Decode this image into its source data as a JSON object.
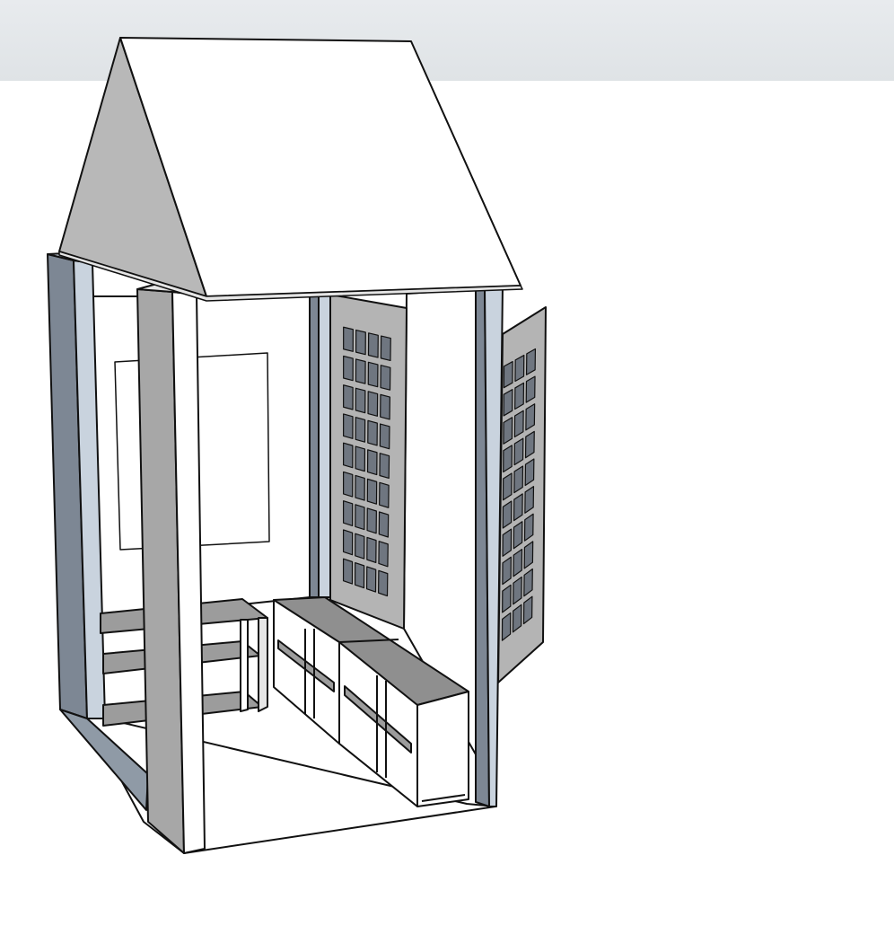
{
  "scene": {
    "subject": "",
    "colors": {
      "sky_top": "#e8ebee",
      "sky_bottom": "#dfe3e6",
      "background": "#ffffff",
      "outline": "#111111",
      "roof_top": "#ffffff",
      "roof_gable": "#b8b8b8",
      "post_front": "#ffffff",
      "post_side": "#a7a7a7",
      "post_blue": "#c9d3de",
      "post_dark": "#7d8794",
      "wall": "#ffffff",
      "cabinet_top": "#8f8f8f",
      "cabinet_shelf": "#9c9c9c",
      "door_panel": "#b4b4b4",
      "glass": "#6f7680",
      "floor": "#ffffff"
    },
    "window_grid": {
      "columns": 4,
      "rows": 9
    },
    "side_window_grid": {
      "columns": 3,
      "rows": 10
    }
  }
}
